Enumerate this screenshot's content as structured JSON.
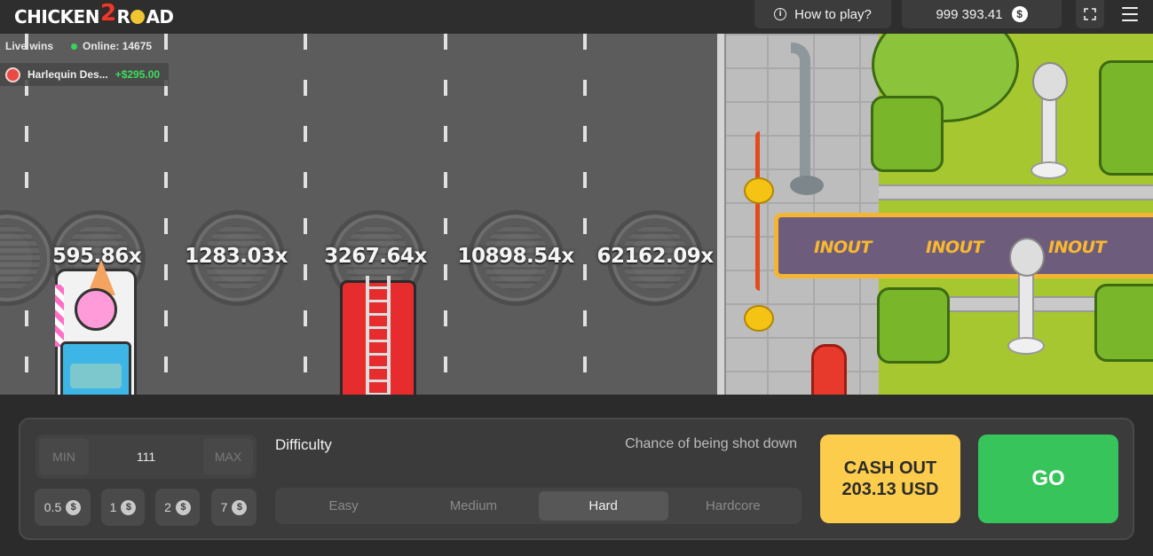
{
  "header": {
    "logo_left": "CHICKEN",
    "logo_mid": "2",
    "logo_right": "R",
    "logo_end": "AD",
    "how_to_play": "How to play?",
    "balance": "999 393.41",
    "currency_symbol": "$",
    "fullscreen_icon": "fullscreen-icon",
    "menu_icon": "hamburger-icon"
  },
  "live": {
    "label": "Live wins",
    "online": "Online: 14675",
    "recent_win_name": "Harlequin Des...",
    "recent_win_amount": "+$295.00"
  },
  "road": {
    "multipliers": [
      "595.86x",
      "1283.03x",
      "3267.64x",
      "10898.54x",
      "62162.09x"
    ]
  },
  "banner": {
    "text": [
      "INOUT",
      "INOUT",
      "INOUT"
    ]
  },
  "controls": {
    "bet": {
      "min_label": "MIN",
      "value": "111",
      "max_label": "MAX"
    },
    "chips": [
      "0.5",
      "1",
      "2",
      "7"
    ],
    "chip_symbol": "$",
    "difficulty_label": "Difficulty",
    "chance_label": "Chance of being shot down",
    "difficulties": [
      "Easy",
      "Medium",
      "Hard",
      "Hardcore"
    ],
    "selected_difficulty": "Hard",
    "cashout_line1": "CASH OUT",
    "cashout_line2": "203.13 USD",
    "go_label": "GO"
  },
  "colors": {
    "cashout": "#fccd4d",
    "go": "#37c45a",
    "win_amount": "#3ddc5e",
    "online_dot": "#37d35a"
  }
}
